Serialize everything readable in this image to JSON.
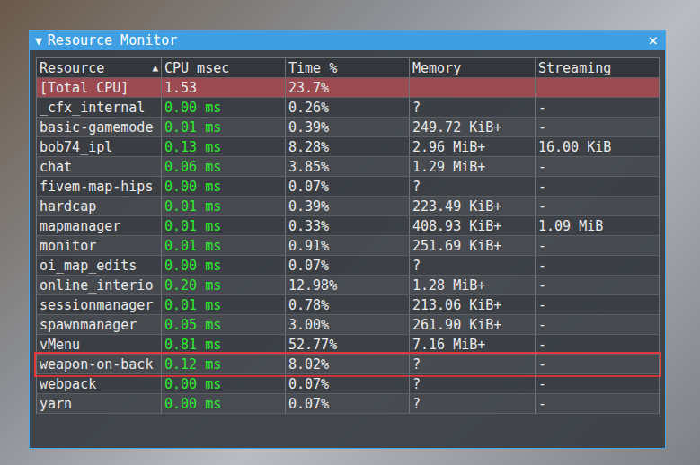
{
  "window": {
    "title": "Resource Monitor",
    "collapse_icon": "▼",
    "close_icon": "×"
  },
  "table": {
    "sort_icon": "▲",
    "columns": [
      {
        "label": "Resource",
        "sorted": true
      },
      {
        "label": "CPU msec",
        "sorted": false
      },
      {
        "label": "Time %",
        "sorted": false
      },
      {
        "label": "Memory",
        "sorted": false
      },
      {
        "label": "Streaming",
        "sorted": false
      }
    ],
    "rows": [
      {
        "kind": "total",
        "highlighted": false,
        "resource": "[Total CPU]",
        "cpu": "1.53",
        "time": "23.7%",
        "memory": "",
        "streaming": ""
      },
      {
        "kind": "resource",
        "highlighted": false,
        "resource": "_cfx_internal",
        "cpu": "0.00 ms",
        "time": "0.26%",
        "memory": "?",
        "streaming": "-"
      },
      {
        "kind": "resource",
        "highlighted": false,
        "resource": "basic-gamemode",
        "cpu": "0.01 ms",
        "time": "0.39%",
        "memory": "249.72 KiB+",
        "streaming": "-"
      },
      {
        "kind": "resource",
        "highlighted": false,
        "resource": "bob74_ipl",
        "cpu": "0.13 ms",
        "time": "8.28%",
        "memory": "2.96 MiB+",
        "streaming": "16.00 KiB"
      },
      {
        "kind": "resource",
        "highlighted": false,
        "resource": "chat",
        "cpu": "0.06 ms",
        "time": "3.85%",
        "memory": "1.29 MiB+",
        "streaming": "-"
      },
      {
        "kind": "resource",
        "highlighted": false,
        "resource": "fivem-map-hips",
        "cpu": "0.00 ms",
        "time": "0.07%",
        "memory": "?",
        "streaming": "-"
      },
      {
        "kind": "resource",
        "highlighted": false,
        "resource": "hardcap",
        "cpu": "0.01 ms",
        "time": "0.39%",
        "memory": "223.49 KiB+",
        "streaming": "-"
      },
      {
        "kind": "resource",
        "highlighted": false,
        "resource": "mapmanager",
        "cpu": "0.01 ms",
        "time": "0.33%",
        "memory": "408.93 KiB+",
        "streaming": "1.09 MiB"
      },
      {
        "kind": "resource",
        "highlighted": false,
        "resource": "monitor",
        "cpu": "0.01 ms",
        "time": "0.91%",
        "memory": "251.69 KiB+",
        "streaming": "-"
      },
      {
        "kind": "resource",
        "highlighted": false,
        "resource": "oi_map_edits",
        "cpu": "0.00 ms",
        "time": "0.07%",
        "memory": "?",
        "streaming": "-"
      },
      {
        "kind": "resource",
        "highlighted": false,
        "resource": "online_interio",
        "cpu": "0.20 ms",
        "time": "12.98%",
        "memory": "1.28 MiB+",
        "streaming": "-"
      },
      {
        "kind": "resource",
        "highlighted": false,
        "resource": "sessionmanager",
        "cpu": "0.01 ms",
        "time": "0.78%",
        "memory": "213.06 KiB+",
        "streaming": "-"
      },
      {
        "kind": "resource",
        "highlighted": false,
        "resource": "spawnmanager",
        "cpu": "0.05 ms",
        "time": "3.00%",
        "memory": "261.90 KiB+",
        "streaming": "-"
      },
      {
        "kind": "resource",
        "highlighted": false,
        "resource": "vMenu",
        "cpu": "0.81 ms",
        "time": "52.77%",
        "memory": "7.16 MiB+",
        "streaming": "-"
      },
      {
        "kind": "resource",
        "highlighted": true,
        "resource": "weapon-on-back",
        "cpu": "0.12 ms",
        "time": "8.02%",
        "memory": "?",
        "streaming": "-"
      },
      {
        "kind": "resource",
        "highlighted": false,
        "resource": "webpack",
        "cpu": "0.00 ms",
        "time": "0.07%",
        "memory": "?",
        "streaming": "-"
      },
      {
        "kind": "resource",
        "highlighted": false,
        "resource": "yarn",
        "cpu": "0.00 ms",
        "time": "0.07%",
        "memory": "?",
        "streaming": "-"
      }
    ]
  }
}
